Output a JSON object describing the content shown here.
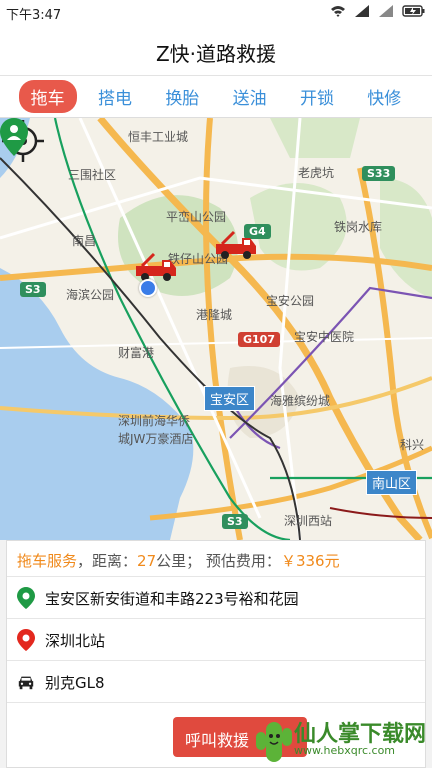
{
  "status": {
    "time": "下午3:47"
  },
  "header": {
    "title": "Z快·道路救援"
  },
  "tabs": [
    {
      "label": "拖车",
      "active": true
    },
    {
      "label": "搭电"
    },
    {
      "label": "换胎"
    },
    {
      "label": "送油"
    },
    {
      "label": "开锁"
    },
    {
      "label": "快修"
    }
  ],
  "map": {
    "labels": {
      "hengfeng": "恒丰工业城",
      "sanwei": "三围社区",
      "laohukeng": "老虎坑",
      "pingluan": "平峦山公园",
      "tiezi": "铁仔山公园",
      "tiegang": "铁岗水库",
      "nanchang": "南昌",
      "haibin": "海滨公园",
      "baoan_park": "宝安公园",
      "ganglong": "港隆城",
      "caifu": "财富港",
      "baoan_hospital": "宝安中医院",
      "haiya": "海雅缤纷城",
      "qianhai1": "深圳前海华侨",
      "qianhai2": "城JW万豪酒店",
      "kexing": "科兴",
      "shenzhen_west": "深圳西站"
    },
    "badges": {
      "s33": "S33",
      "g4": "G4",
      "s3_left": "S3",
      "s3_bottom": "S3",
      "g107": "G107"
    },
    "districts": {
      "baoan": "宝安区",
      "nanshan": "南山区"
    }
  },
  "order": {
    "service": "拖车服务",
    "distance_prefix": "，距离：",
    "distance": "27",
    "distance_unit": "公里；",
    "fee_prefix": "预估费用：",
    "fee": "￥336元",
    "origin": "宝安区新安街道和丰路223号裕和花园",
    "destination": "深圳北站",
    "car": "别克GL8",
    "call_button": "呼叫救援"
  },
  "watermark": {
    "text": "仙人掌下载网",
    "url": "www.hebxqrc.com"
  },
  "colors": {
    "accent": "#e8594b",
    "tab_blue": "#3a8fd9",
    "price": "#f08a1c"
  }
}
